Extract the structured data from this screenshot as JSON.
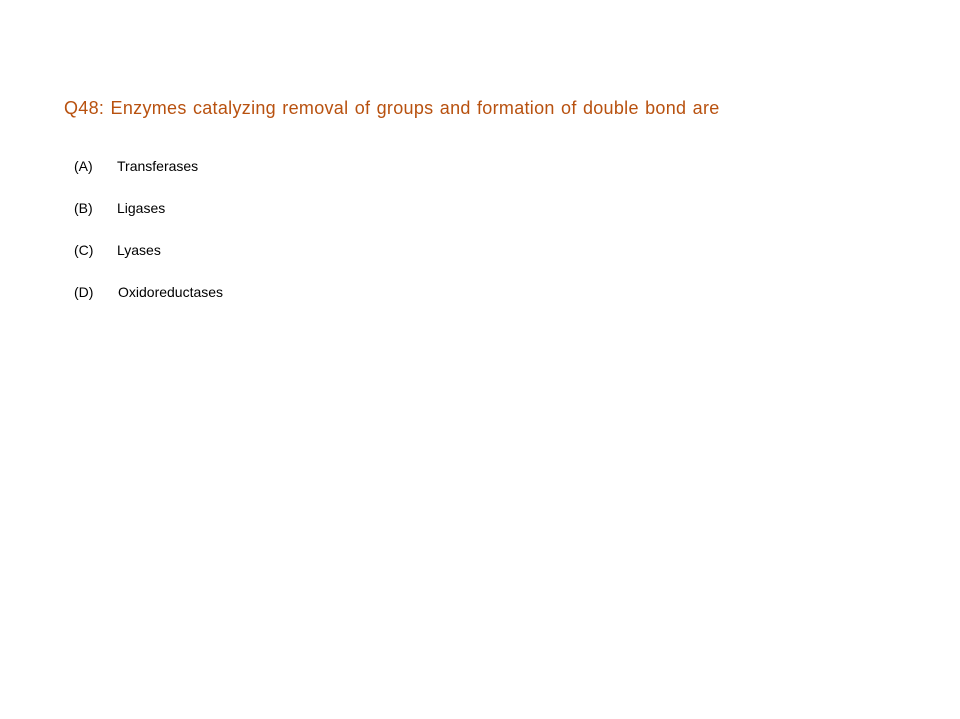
{
  "theme": {
    "question_color": "#B8510F",
    "text_color": "#000000",
    "background": "#FFFFFF"
  },
  "question": {
    "text": "Q48: Enzymes catalyzing removal of groups and formation of double bond are"
  },
  "options": [
    {
      "letter": "(A)",
      "text": "Transferases"
    },
    {
      "letter": "(B)",
      "text": "Ligases"
    },
    {
      "letter": "(C)",
      "text": "Lyases"
    },
    {
      "letter": "(D)",
      "text": "Oxidoreductases"
    }
  ]
}
